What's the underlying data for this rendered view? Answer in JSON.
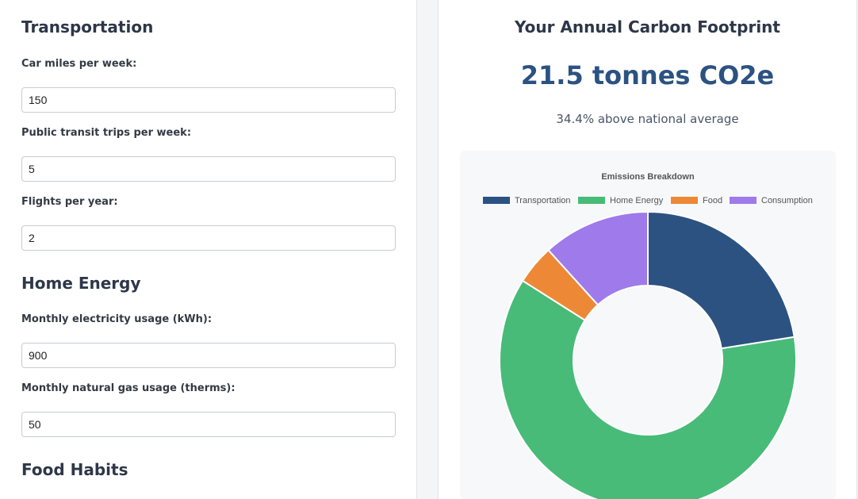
{
  "transportation": {
    "title": "Transportation",
    "car_miles_label": "Car miles per week:",
    "car_miles_value": "150",
    "transit_label": "Public transit trips per week:",
    "transit_value": "5",
    "flights_label": "Flights per year:",
    "flights_value": "2"
  },
  "home_energy": {
    "title": "Home Energy",
    "electricity_label": "Monthly electricity usage (kWh):",
    "electricity_value": "900",
    "gas_label": "Monthly natural gas usage (therms):",
    "gas_value": "50"
  },
  "food": {
    "title": "Food Habits"
  },
  "results": {
    "title": "Your Annual Carbon Footprint",
    "total": "21.5 tonnes CO2e",
    "comparison": "34.4% above national average"
  },
  "chart_data": {
    "type": "doughnut",
    "title": "Emissions Breakdown",
    "legend_position": "top",
    "categories": [
      "Transportation",
      "Home Energy",
      "Food",
      "Consumption"
    ],
    "values": [
      22.5,
      61.5,
      4.3,
      11.7
    ],
    "colors": [
      "#2c5282",
      "#48bb78",
      "#ed8936",
      "#9f7aea"
    ]
  }
}
